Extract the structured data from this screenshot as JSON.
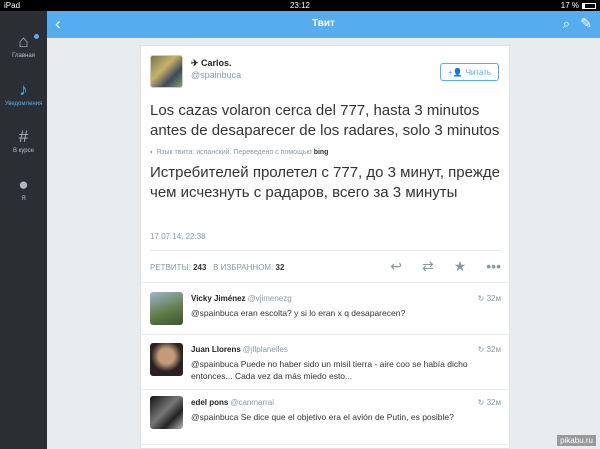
{
  "status_bar": {
    "device": "iPad",
    "time": "23:12",
    "battery": "17 %"
  },
  "sidebar": {
    "items": [
      {
        "icon": "home-icon",
        "label": "Главная"
      },
      {
        "icon": "bell-icon",
        "label": "Уведомления"
      },
      {
        "icon": "hash-icon",
        "label": "В курсе"
      },
      {
        "icon": "user-icon",
        "label": "Я"
      }
    ]
  },
  "topbar": {
    "title": "Твит"
  },
  "tweet": {
    "name": "Carlos.",
    "handle": "@spainbuca",
    "follow_label": "Читать",
    "text": "Los cazas volaron cerca del 777, hasta 3 minutos antes de desaparecer de los radares, solo 3 minutos",
    "lang_note": "Язык твита: испанский. Переведено с помощью",
    "translator": "bing",
    "translation": "Истребителей пролетел с 777, до 3 минут, прежде чем исчезнуть с радаров, всего за 3 минуты",
    "timestamp": "17.07.14, 22:38",
    "retweets_label": "РЕТВИТЫ:",
    "retweets": "243",
    "favorites_label": "В ИЗБРАННОМ:",
    "favorites": "32"
  },
  "replies": [
    {
      "name": "Vicky Jiménez",
      "handle": "@vjimenezg",
      "time": "32м",
      "text": "@spainbuca eran escolta? y si lo eran x q desaparecen?"
    },
    {
      "name": "Juan Llorens",
      "handle": "@jllplanelles",
      "time": "32м",
      "text": "@spainbuca Puede no haber sido un misil tierra - aire coo se había dicho entonces... Cada vez da más miedo esto..."
    },
    {
      "name": "edel pons",
      "handle": "@canmarrai",
      "time": "32м",
      "text": "@spainbuca Se dice que el objetivo era el avión de Putin, es posible?"
    }
  ],
  "watermark": "pikabu.ru",
  "colors": {
    "accent": "#55acee",
    "sidebar": "#2b2f33"
  }
}
